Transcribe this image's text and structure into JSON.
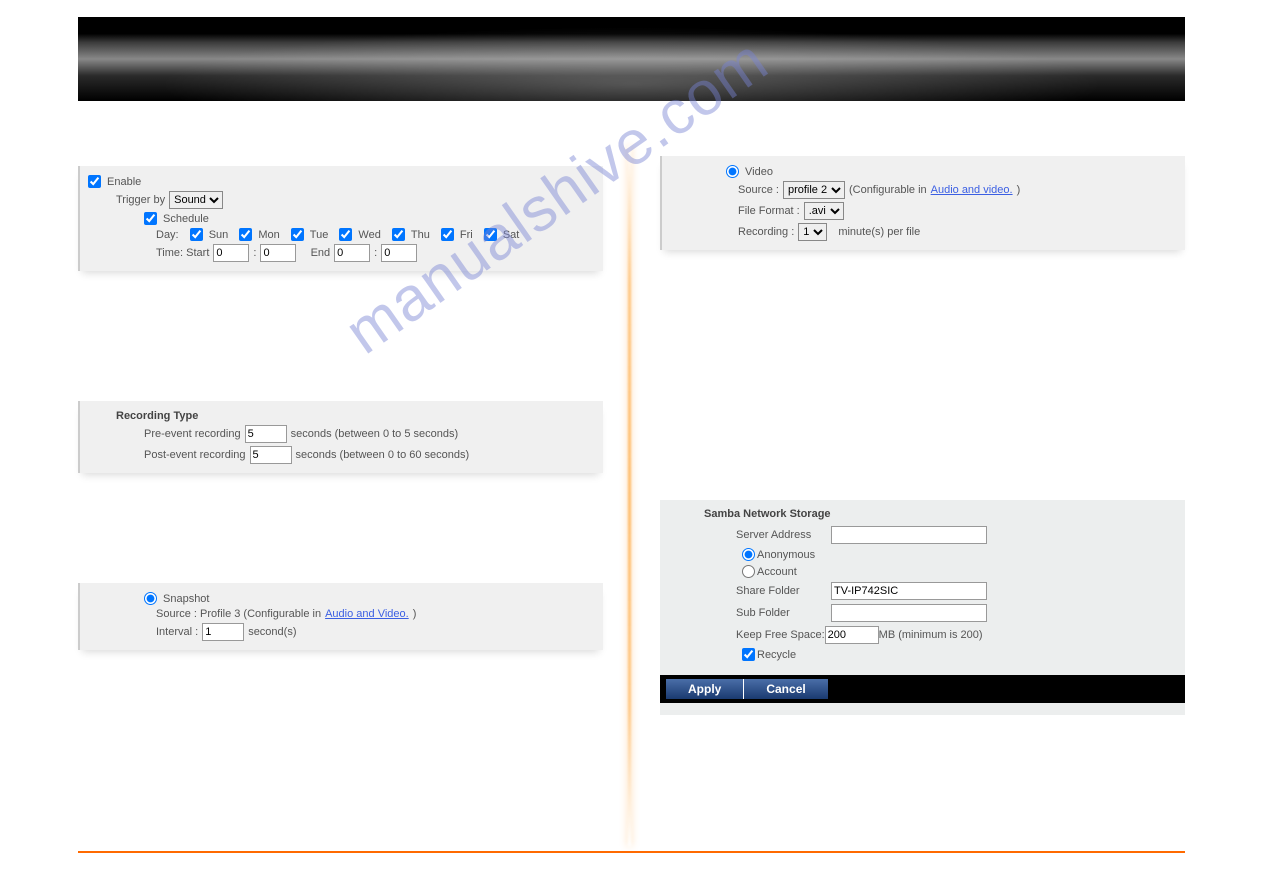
{
  "watermark": "manualshive.com",
  "enable_panel": {
    "enable_label": "Enable",
    "trigger_by_label": "Trigger by",
    "trigger_by_value": "Sound",
    "schedule_label": "Schedule",
    "day_label": "Day:",
    "days": {
      "sun": "Sun",
      "mon": "Mon",
      "tue": "Tue",
      "wed": "Wed",
      "thu": "Thu",
      "fri": "Fri",
      "sat": "Sat"
    },
    "time_start_label": "Time: Start",
    "time_end_label": "End",
    "start_h": "0",
    "start_m": "0",
    "end_h": "0",
    "end_m": "0"
  },
  "recording_type": {
    "title": "Recording Type",
    "pre_label": "Pre-event recording",
    "pre_value": "5",
    "pre_hint": "seconds  (between 0 to 5 seconds)",
    "post_label": "Post-event recording",
    "post_value": "5",
    "post_hint": "seconds  (between 0 to 60 seconds)"
  },
  "snapshot": {
    "radio_label": "Snapshot",
    "source_label": "Source : Profile 3  (Configurable in ",
    "source_link": "Audio and Video.",
    "source_close": ")",
    "interval_label": "Interval :",
    "interval_value": "1",
    "interval_unit": "second(s)"
  },
  "video": {
    "radio_label": "Video",
    "source_label": "Source :",
    "source_value": "profile 2",
    "config_open": "(Configurable in ",
    "config_link": "Audio and video.",
    "config_close": ")",
    "format_label": "File Format :",
    "format_value": ".avi",
    "recording_label": "Recording :",
    "recording_value": "1",
    "recording_unit": "minute(s) per file"
  },
  "samba": {
    "title": "Samba Network Storage",
    "server_label": "Server Address",
    "server_value": "",
    "anon_label": "Anonymous",
    "account_label": "Account",
    "share_label": "Share Folder",
    "share_value": "TV-IP742SIC",
    "sub_label": "Sub Folder",
    "sub_value": "",
    "keep_label": "Keep Free Space:",
    "keep_value": "200",
    "keep_unit": "MB (minimum is 200)",
    "recycle_label": "Recycle",
    "apply": "Apply",
    "cancel": "Cancel"
  }
}
